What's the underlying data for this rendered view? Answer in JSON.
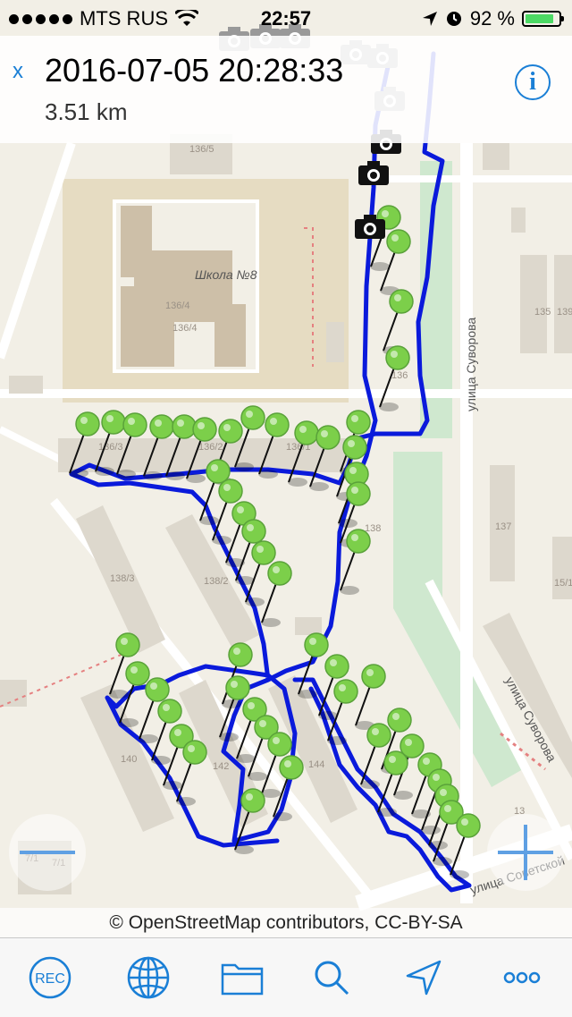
{
  "status_bar": {
    "carrier": "MTS RUS",
    "time": "22:57",
    "battery": "92 %",
    "battery_level": 0.92
  },
  "header": {
    "close_label": "x",
    "title": "2016-07-05 20:28:33",
    "distance": "3.51 km",
    "info_label": "i"
  },
  "map": {
    "street_labels": [
      "улица Суворова",
      "улица Суворова",
      "улица Советской"
    ],
    "school_label": "Школа №8",
    "building_numbers": [
      "136/5",
      "136/4",
      "136/4",
      "136/3",
      "136/2",
      "136/1",
      "136",
      "135",
      "139",
      "137",
      "138",
      "138/3",
      "138/2",
      "140",
      "142",
      "144",
      "15/1",
      "13",
      "7/1",
      "7/1"
    ],
    "track_color": "#0a1adb",
    "marker_color": "#7ccf4a"
  },
  "attribution": "© OpenStreetMap contributors, CC-BY-SA",
  "toolbar": {
    "rec_label": "REC",
    "icons": [
      "globe-icon",
      "folder-icon",
      "search-icon",
      "location-arrow-icon",
      "more-icon"
    ]
  }
}
